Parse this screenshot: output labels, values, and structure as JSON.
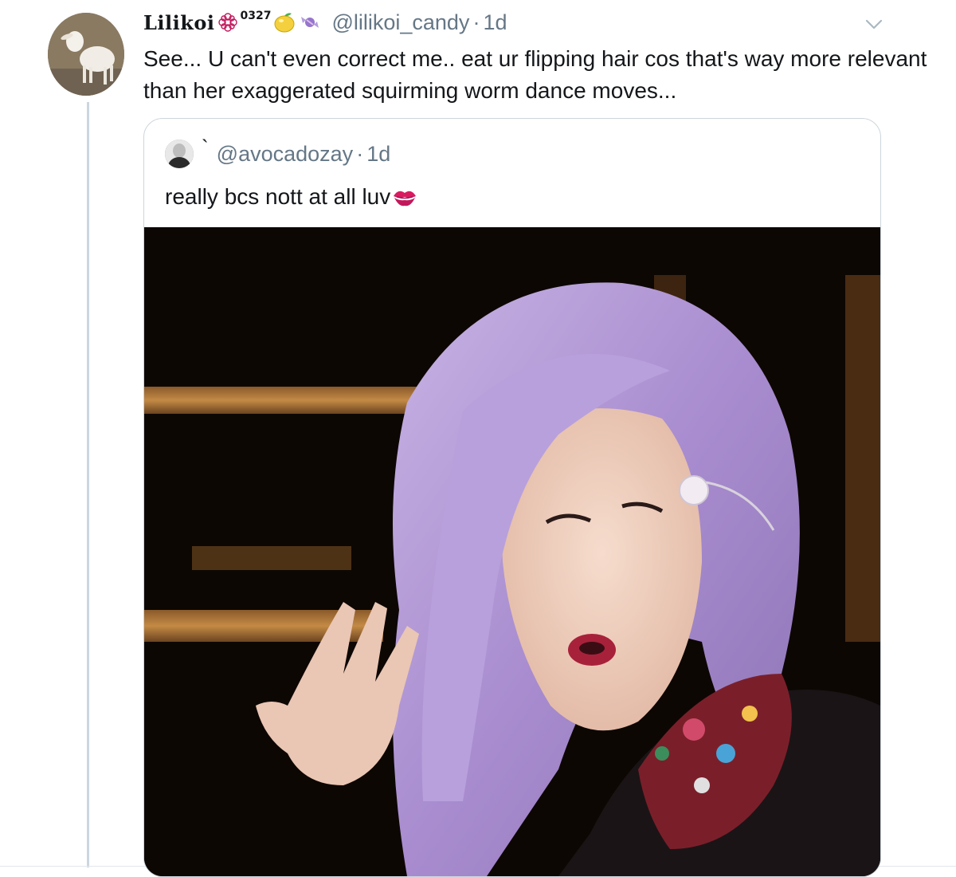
{
  "tweet": {
    "display_name": "Lilikoi",
    "name_number": "0327",
    "handle": "@lilikoi_candy",
    "separator": "·",
    "time": "1d",
    "text": "See... U can't even correct me.. eat ur flipping hair cos that's way more relevant than her exaggerated squirming worm dance moves...",
    "icons": {
      "avatar": "goat-avatar",
      "badge": "flower-badge-icon",
      "emoji_1": "lemon-emoji",
      "emoji_2": "candy-emoji",
      "menu": "chevron-down-icon"
    }
  },
  "quote": {
    "display_name": "`",
    "handle": "@avocadozay",
    "separator": "·",
    "time": "1d",
    "text": "really bcs nott at all luv",
    "icons": {
      "avatar": "user-avatar",
      "emoji": "kiss-mark-emoji",
      "media": "performer-photo"
    }
  },
  "colors": {
    "text": "#14171a",
    "secondary": "#657786",
    "border": "#ccd6dd",
    "hair": "#b49ad4"
  }
}
